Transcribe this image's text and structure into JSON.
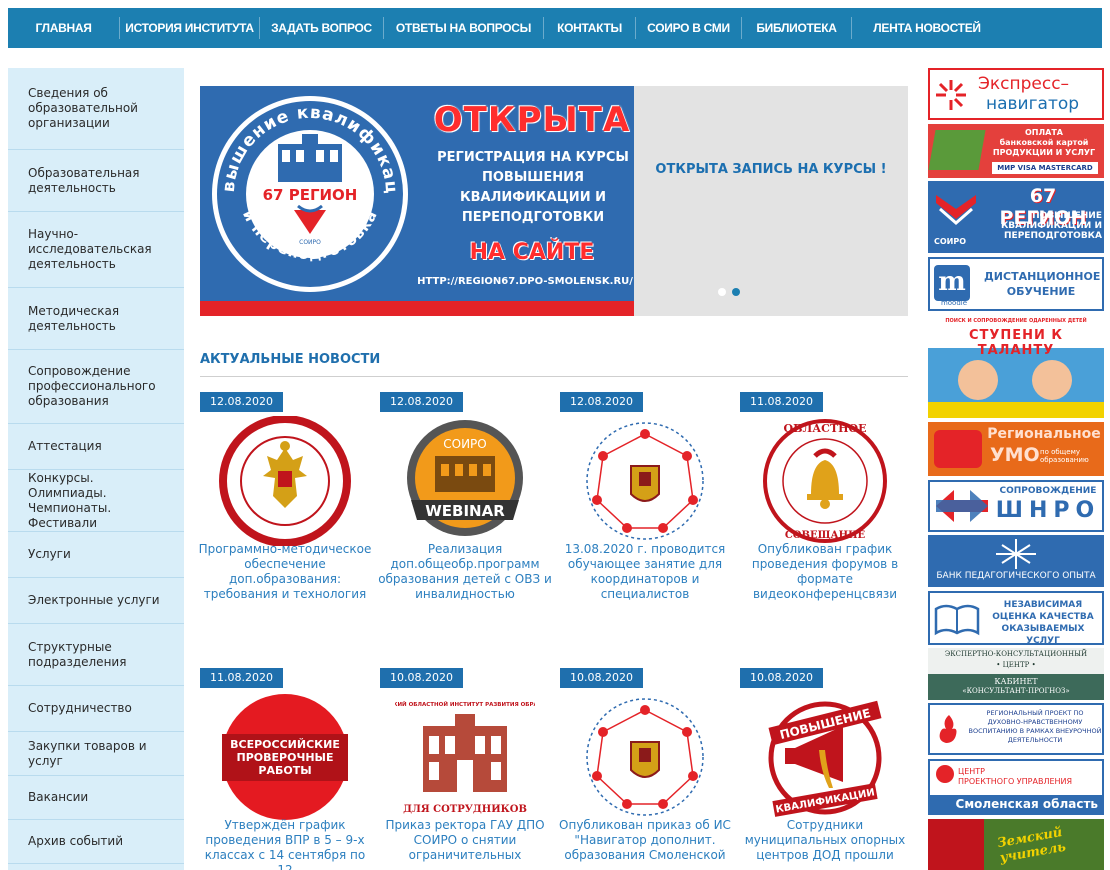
{
  "nav": [
    "Главная",
    "История института",
    "Задать вопрос",
    "Ответы на вопросы",
    "Контакты",
    "СОИРО в СМИ",
    "Библиотека",
    "Лента новостей"
  ],
  "sidebar": [
    "Сведения об образовательной организации",
    "Образовательная деятельность",
    "Научно-исследовательская деятельность",
    "Методическая деятельность",
    "Сопровождение профессионального образования",
    "Аттестация",
    "Конкурсы. Олимпиады. Чемпионаты. Фестивали",
    "Услуги",
    "Электронные услуги",
    "Структурные подразделения",
    "Сотрудничество",
    "Закупки товаров и услуг",
    "Вакансии",
    "Архив событий"
  ],
  "slider": {
    "seal_top": "Повышение квалификации",
    "seal_bottom": "и переподготовка",
    "seal_region": "67 РЕГИОН",
    "seal_small": "СОИРО",
    "open": "ОТКРЫТА",
    "registration": "РЕГИСТРАЦИЯ НА КУРСЫ ПОВЫШЕНИЯ КВАЛИФИКАЦИИ И ПЕРЕПОДГОТОВКИ",
    "on_site": "НА САЙТЕ",
    "url": "HTTP://REGION67.DPO-SMOLENSK.RU/",
    "right_text": "ОТКРЫТА ЗАПИСЬ НА КУРСЫ !",
    "active_slide": 2,
    "slide_count": 2
  },
  "news": {
    "heading": "Актуальные новости",
    "items": [
      {
        "date": "12.08.2020",
        "title": "Программно-методическое обеспечение доп.образования: требования и технология",
        "icon": "all-russian-event-emblem"
      },
      {
        "date": "12.08.2020",
        "title": "Реализация доп.общеобр.программ образования детей с ОВЗ и инвалидностью",
        "icon": "soiro-webinar-badge",
        "label_top": "СОИРО",
        "label_bottom": "WEBINAR"
      },
      {
        "date": "12.08.2020",
        "title": "13.08.2020 г. проводится обучающее занятие для координаторов и специалистов",
        "icon": "priority-project-emblem"
      },
      {
        "date": "11.08.2020",
        "title": "Опубликован график проведения форумов в формате видеоконференцсвязи",
        "icon": "august-meeting-emblem",
        "label_top": "ОБЛАСТНОЕ",
        "label_left": "АВГУСТОВСКОЕ",
        "label_bottom": "СОВЕЩАНИЕ"
      },
      {
        "date": "11.08.2020",
        "title": "Утверждён график проведения ВПР в 5 – 9-х классах с 14 сентября по 12",
        "icon": "vpr-badge",
        "label": "ВСЕРОССИЙСКИЕ ПРОВЕРОЧНЫЕ РАБОТЫ"
      },
      {
        "date": "10.08.2020",
        "title": "Приказ ректора ГАУ ДПО СОИРО о снятии ограничительных",
        "icon": "staff-building",
        "label_top": "СМОЛЕНСКИЙ ОБЛАСТНОЙ ИНСТИТУТ РАЗВИТИЯ ОБРАЗОВАНИЯ",
        "label_bottom": "ДЛЯ СОТРУДНИКОВ"
      },
      {
        "date": "10.08.2020",
        "title": "Опубликован приказ об ИС \"Навигатор дополнит. образования Смоленской",
        "icon": "priority-project-emblem"
      },
      {
        "date": "10.08.2020",
        "title": "Сотрудники муниципальных опорных центров ДОД прошли",
        "icon": "megaphone-emblem",
        "label_top": "ПОВЫШЕНИЕ",
        "label_bottom": "КВАЛИФИКАЦИИ"
      }
    ]
  },
  "banners": {
    "express": {
      "line1": "Экспресс–",
      "line2": "навигатор"
    },
    "payment": {
      "line1": "ОПЛАТА",
      "line2": "банковской картой",
      "line3": "ПРОДУКЦИИ И УСЛУГ",
      "cards": "МИР  VISA  mastercard"
    },
    "region67": {
      "title": "67 РЕГИОН",
      "text": "ПОВЫШЕНИЕ КВАЛИФИКАЦИИ И ПЕРЕПОДГОТОВКА",
      "small": "СОИРО"
    },
    "distance": {
      "text": "ДИСТАНЦИОННОЕ ОБУЧЕНИЕ",
      "small": "moodle"
    },
    "talent": {
      "small": "ПОИСК И СОПРОВОЖДЕНИЕ ОДАРЕННЫХ ДЕТЕЙ",
      "title": "СТУПЕНИ К ТАЛАНТУ"
    },
    "umo": {
      "line1": "Региональное",
      "line2": "УМО",
      "line3": "по общему образованию"
    },
    "shnro": {
      "line1": "СОПРОВОЖДЕНИЕ",
      "line2": "ШНРО"
    },
    "bank": {
      "text": "БАНК ПЕДАГОГИЧЕСКОГО ОПЫТА"
    },
    "quality": {
      "text": "НЕЗАВИСИМАЯ ОЦЕНКА КАЧЕСТВА ОКАЗЫВАЕМЫХ УСЛУГ"
    },
    "expert": {
      "line1": "ЭКСПЕРТНО-КОНСУЛЬТАЦИОННЫЙ",
      "line2": "• ЦЕНТР •",
      "line3": "КАБИНЕТ",
      "line4": "«КОНСУЛЬТАНТ-ПРОГНОЗ»"
    },
    "spiritual": {
      "text": "РЕГИОНАЛЬНЫЙ ПРОЕКТ ПО ДУХОВНО-НРАВСТВЕННОМУ ВОСПИТАНИЮ В РАМКАХ ВНЕУРОЧНОЙ ДЕЯТЕЛЬНОСТИ"
    },
    "project": {
      "line1": "ЦЕНТР",
      "line2": "ПРОЕКТНОГО УПРАВЛЕНИЯ",
      "line3": "Смоленская область"
    },
    "zemsky": {
      "text": "Земский учитель"
    }
  },
  "colors": {
    "nav": "#1c7fb1",
    "sidebar": "#d9eef9",
    "accent": "#1f6fad",
    "red": "#e42328",
    "link": "#2c7fbf"
  }
}
